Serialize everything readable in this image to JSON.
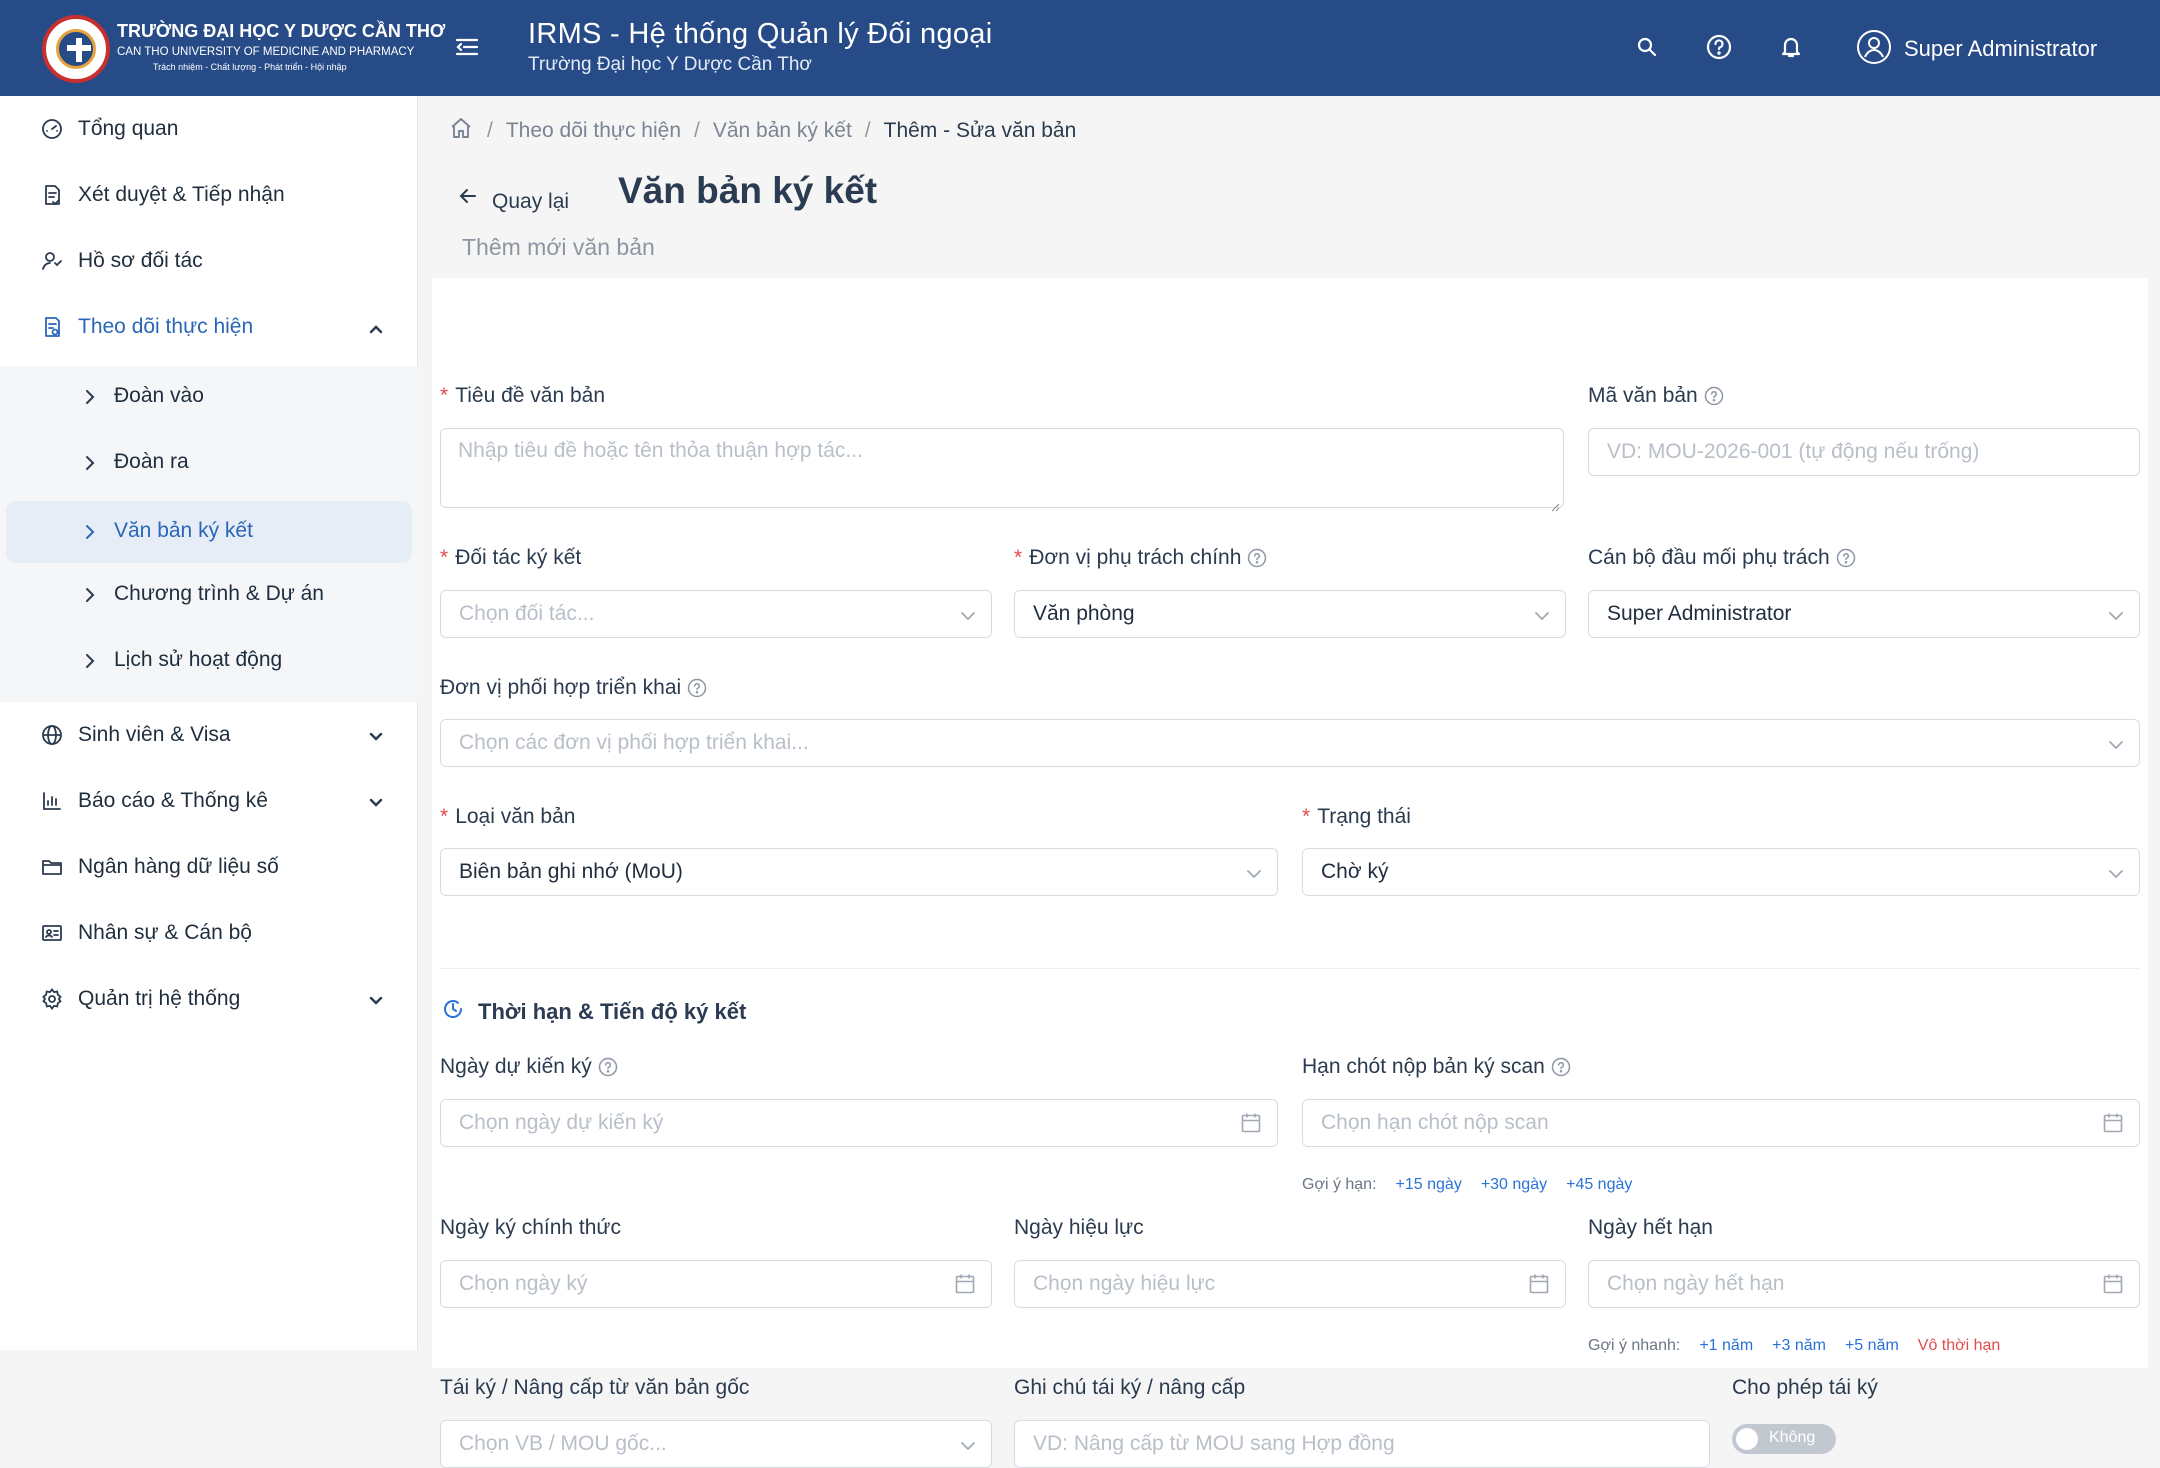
{
  "header": {
    "brand_line1": "TRƯỜNG ĐẠI HỌC Y DƯỢC CẦN THƠ",
    "brand_line2": "CAN THO UNIVERSITY OF MEDICINE AND PHARMACY",
    "brand_line3": "Trách nhiệm - Chất lượng - Phát triển - Hội nhập",
    "app_title": "IRMS - Hệ thống Quản lý Đối ngoại",
    "app_subtitle": "Trường Đại học Y Dược Cần Thơ",
    "user_name": "Super Administrator",
    "accent": "#274b87"
  },
  "sidebar": {
    "items": [
      {
        "label": "Tổng quan",
        "icon": "dashboard-icon"
      },
      {
        "label": "Xét duyệt & Tiếp nhận",
        "icon": "document-check-icon"
      },
      {
        "label": "Hồ sơ đối tác",
        "icon": "partner-icon"
      },
      {
        "label": "Theo dõi thực hiện",
        "icon": "tracking-icon"
      },
      {
        "label": "Sinh viên & Visa",
        "icon": "globe-icon"
      },
      {
        "label": "Báo cáo & Thống kê",
        "icon": "bar-chart-icon"
      },
      {
        "label": "Ngân hàng dữ liệu số",
        "icon": "folder-icon"
      },
      {
        "label": "Nhân sự & Cán bộ",
        "icon": "id-card-icon"
      },
      {
        "label": "Quản trị hệ thống",
        "icon": "gear-icon"
      }
    ],
    "subitems": [
      {
        "label": "Đoàn vào"
      },
      {
        "label": "Đoàn ra"
      },
      {
        "label": "Văn bản ký kết"
      },
      {
        "label": "Chương trình & Dự án"
      },
      {
        "label": "Lịch sử hoạt động"
      }
    ]
  },
  "breadcrumb": {
    "items": [
      "Theo dõi thực hiện",
      "Văn bản ký kết",
      "Thêm - Sửa văn bản"
    ],
    "separator": "/"
  },
  "page": {
    "back_label": "Quay lại",
    "title": "Văn bản ký kết",
    "subtitle": "Thêm mới văn bản"
  },
  "form": {
    "required_mark": "*",
    "title": {
      "label": "Tiêu đề văn bản",
      "placeholder": "Nhập tiêu đề hoặc tên thỏa thuận hợp tác..."
    },
    "code": {
      "label": "Mã văn bản",
      "placeholder": "VD: MOU-2026-001 (tự động nếu trống)"
    },
    "partner": {
      "label": "Đối tác ký kết",
      "placeholder": "Chọn đối tác..."
    },
    "unit": {
      "label": "Đơn vị phụ trách chính",
      "value": "Văn phòng"
    },
    "officer": {
      "label": "Cán bộ đầu mối phụ trách",
      "value": "Super Administrator"
    },
    "coop_units": {
      "label": "Đơn vị phối hợp triển khai",
      "placeholder": "Chọn các đơn vị phối hợp triển khai..."
    },
    "doc_type": {
      "label": "Loại văn bản",
      "value": "Biên bản ghi nhớ (MoU)"
    },
    "status": {
      "label": "Trạng thái",
      "value": "Chờ ký"
    },
    "section_title": "Thời hạn & Tiến độ ký kết",
    "expected_date": {
      "label": "Ngày dự kiến ký",
      "placeholder": "Chọn ngày dự kiến ký"
    },
    "scan_deadline": {
      "label": "Hạn chót nộp bản ký scan",
      "placeholder": "Chọn hạn chót nộp scan"
    },
    "scan_hints": {
      "label": "Gợi ý hạn:",
      "chips": [
        "+15 ngày",
        "+30 ngày",
        "+45 ngày"
      ]
    },
    "sign_date": {
      "label": "Ngày ký chính thức",
      "placeholder": "Chọn ngày ký"
    },
    "effective_date": {
      "label": "Ngày hiệu lực",
      "placeholder": "Chọn ngày hiệu lực"
    },
    "expiry_date": {
      "label": "Ngày hết hạn",
      "placeholder": "Chọn ngày hết hạn"
    },
    "expiry_hints": {
      "label": "Gợi ý nhanh:",
      "chips": [
        "+1 năm",
        "+3 năm",
        "+5 năm",
        "Vô thời hạn"
      ]
    },
    "renew_from": {
      "label": "Tái ký / Nâng cấp từ văn bản gốc",
      "placeholder": "Chọn VB / MOU gốc..."
    },
    "renew_note": {
      "label": "Ghi chú tái ký / nâng cấp",
      "placeholder": "VD: Nâng cấp từ MOU sang Hợp đồng"
    },
    "allow_renew": {
      "label": "Cho phép tái ký",
      "toggle_label": "Không"
    }
  }
}
